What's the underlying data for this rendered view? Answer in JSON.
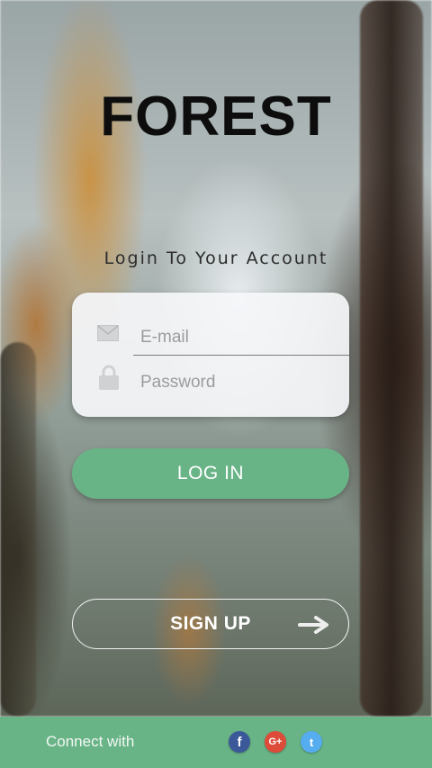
{
  "app": {
    "logo": "FOREST",
    "subtitle": "Login To Your Account"
  },
  "login_form": {
    "email_placeholder": "E-mail",
    "password_placeholder": "Password",
    "login_label": "LOG IN"
  },
  "signup": {
    "label": "SIGN UP"
  },
  "footer": {
    "connect_label": "Connect with",
    "social": [
      {
        "name": "facebook",
        "glyph": "f",
        "icon": "facebook-icon",
        "color": "#3b5998"
      },
      {
        "name": "google-plus",
        "glyph": "G+",
        "icon": "google-plus-icon",
        "color": "#dd4b39"
      },
      {
        "name": "twitter",
        "glyph": "t",
        "icon": "twitter-icon",
        "color": "#55acee"
      }
    ]
  },
  "colors": {
    "accent": "#69b487",
    "logo_text": "#0d0d0d"
  }
}
